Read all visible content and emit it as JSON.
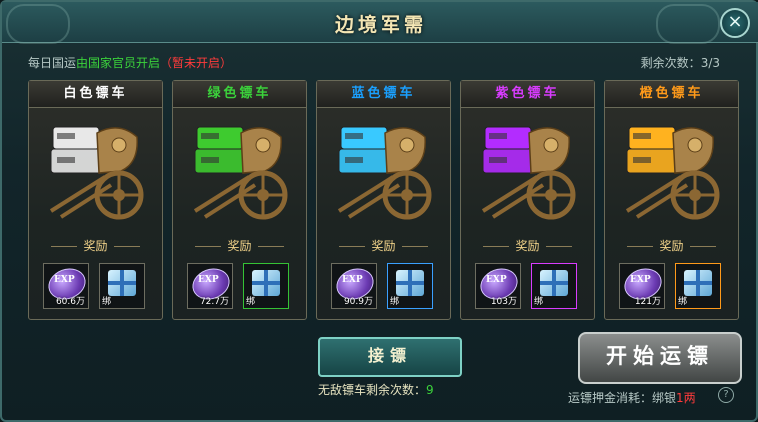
{
  "title": "边境军需",
  "info": {
    "prefix": "每日国运",
    "green": "由国家官员开启",
    "red": "（暂未开启）"
  },
  "remaining": {
    "label": "剩余次数：",
    "value": "3/3"
  },
  "cards": [
    {
      "name": "白色镖车",
      "color": "#ffffff",
      "box": "#e8e8e8",
      "reward_label": "奖励",
      "exp": "60.6万",
      "bind": "绑"
    },
    {
      "name": "绿色镖车",
      "color": "#3bd23b",
      "box": "#3ecb2f",
      "reward_label": "奖励",
      "exp": "72.7万",
      "bind": "绑"
    },
    {
      "name": "蓝色镖车",
      "color": "#1aa0ff",
      "box": "#39c9ff",
      "reward_label": "奖励",
      "exp": "90.9万",
      "bind": "绑"
    },
    {
      "name": "紫色镖车",
      "color": "#d93cff",
      "box": "#b32cff",
      "reward_label": "奖励",
      "exp": "103万",
      "bind": "绑"
    },
    {
      "name": "橙色镖车",
      "color": "#ff9a1a",
      "box": "#ffb21f",
      "reward_label": "奖励",
      "exp": "121万",
      "bind": "绑"
    }
  ],
  "exp_icon_text": "EXP",
  "accept_button": "接镖",
  "invincible": {
    "label": "无敌镖车剩余次数：",
    "value": "9"
  },
  "start_button": "开始运镖",
  "cost": {
    "label": "运镖押金消耗：绑银",
    "value": "1两"
  },
  "close_symbol": "×",
  "help_symbol": "?"
}
